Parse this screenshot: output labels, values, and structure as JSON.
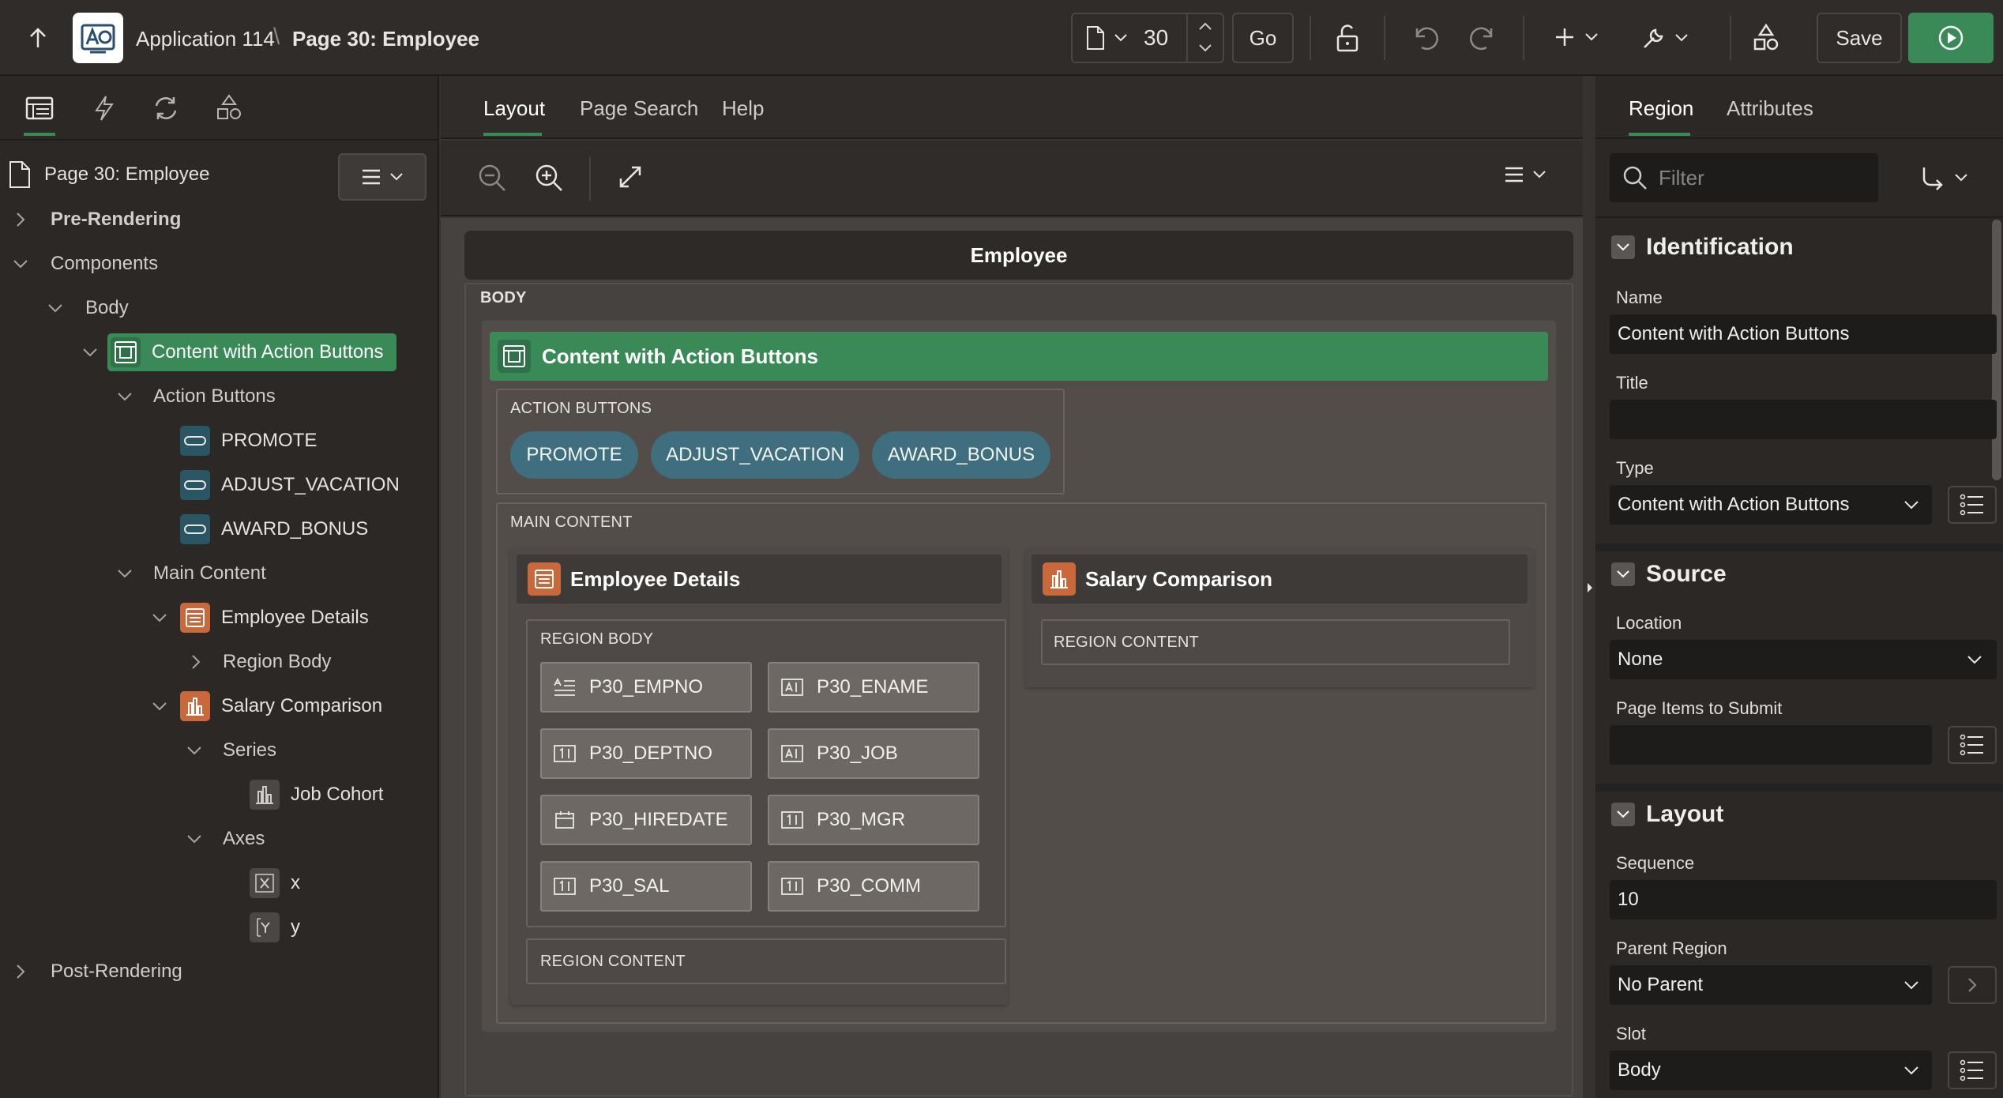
{
  "header": {
    "app_name": "Application 114",
    "separator": "\\",
    "page_title": "Page 30: Employee",
    "page_number": "30",
    "go_label": "Go",
    "save_label": "Save"
  },
  "left_panel": {
    "page_node": "Page 30: Employee",
    "tree": {
      "pre_rendering": "Pre-Rendering",
      "components": "Components",
      "body": "Body",
      "content_region": "Content with Action Buttons",
      "action_buttons": "Action Buttons",
      "buttons": [
        "PROMOTE",
        "ADJUST_VACATION",
        "AWARD_BONUS"
      ],
      "main_content": "Main Content",
      "employee_details": "Employee Details",
      "region_body": "Region Body",
      "salary_comparison": "Salary Comparison",
      "series": "Series",
      "job_cohort": "Job Cohort",
      "axes": "Axes",
      "axis_x": "x",
      "axis_y": "y",
      "post_rendering": "Post-Rendering"
    }
  },
  "center": {
    "tabs": [
      "Layout",
      "Page Search",
      "Help"
    ],
    "active_tab": "Layout",
    "page_header": "Employee",
    "body_label": "BODY",
    "region_title": "Content with Action Buttons",
    "action_buttons_label": "ACTION BUTTONS",
    "buttons": [
      "PROMOTE",
      "ADJUST_VACATION",
      "AWARD_BONUS"
    ],
    "main_content_label": "MAIN CONTENT",
    "employee_details": {
      "title": "Employee Details",
      "region_body_label": "REGION BODY",
      "items": [
        "P30_EMPNO",
        "P30_ENAME",
        "P30_DEPTNO",
        "P30_JOB",
        "P30_HIREDATE",
        "P30_MGR",
        "P30_SAL",
        "P30_COMM"
      ],
      "region_content_label": "REGION CONTENT"
    },
    "salary_comparison": {
      "title": "Salary Comparison",
      "region_content_label": "REGION CONTENT"
    }
  },
  "right_panel": {
    "tabs": [
      "Region",
      "Attributes"
    ],
    "active_tab": "Region",
    "filter_placeholder": "Filter",
    "identification": {
      "title": "Identification",
      "name_label": "Name",
      "name_value": "Content with Action Buttons",
      "title_label": "Title",
      "title_value": "",
      "type_label": "Type",
      "type_value": "Content with Action Buttons"
    },
    "source": {
      "title": "Source",
      "location_label": "Location",
      "location_value": "None",
      "items_submit_label": "Page Items to Submit",
      "items_submit_value": ""
    },
    "layout": {
      "title": "Layout",
      "sequence_label": "Sequence",
      "sequence_value": "10",
      "parent_label": "Parent Region",
      "parent_value": "No Parent",
      "slot_label": "Slot",
      "slot_value": "Body"
    }
  },
  "colors": {
    "accent_green": "#3a8a58",
    "button_teal": "#3f6e7e",
    "icon_orange": "#c9683a",
    "background": "#2b2825"
  }
}
